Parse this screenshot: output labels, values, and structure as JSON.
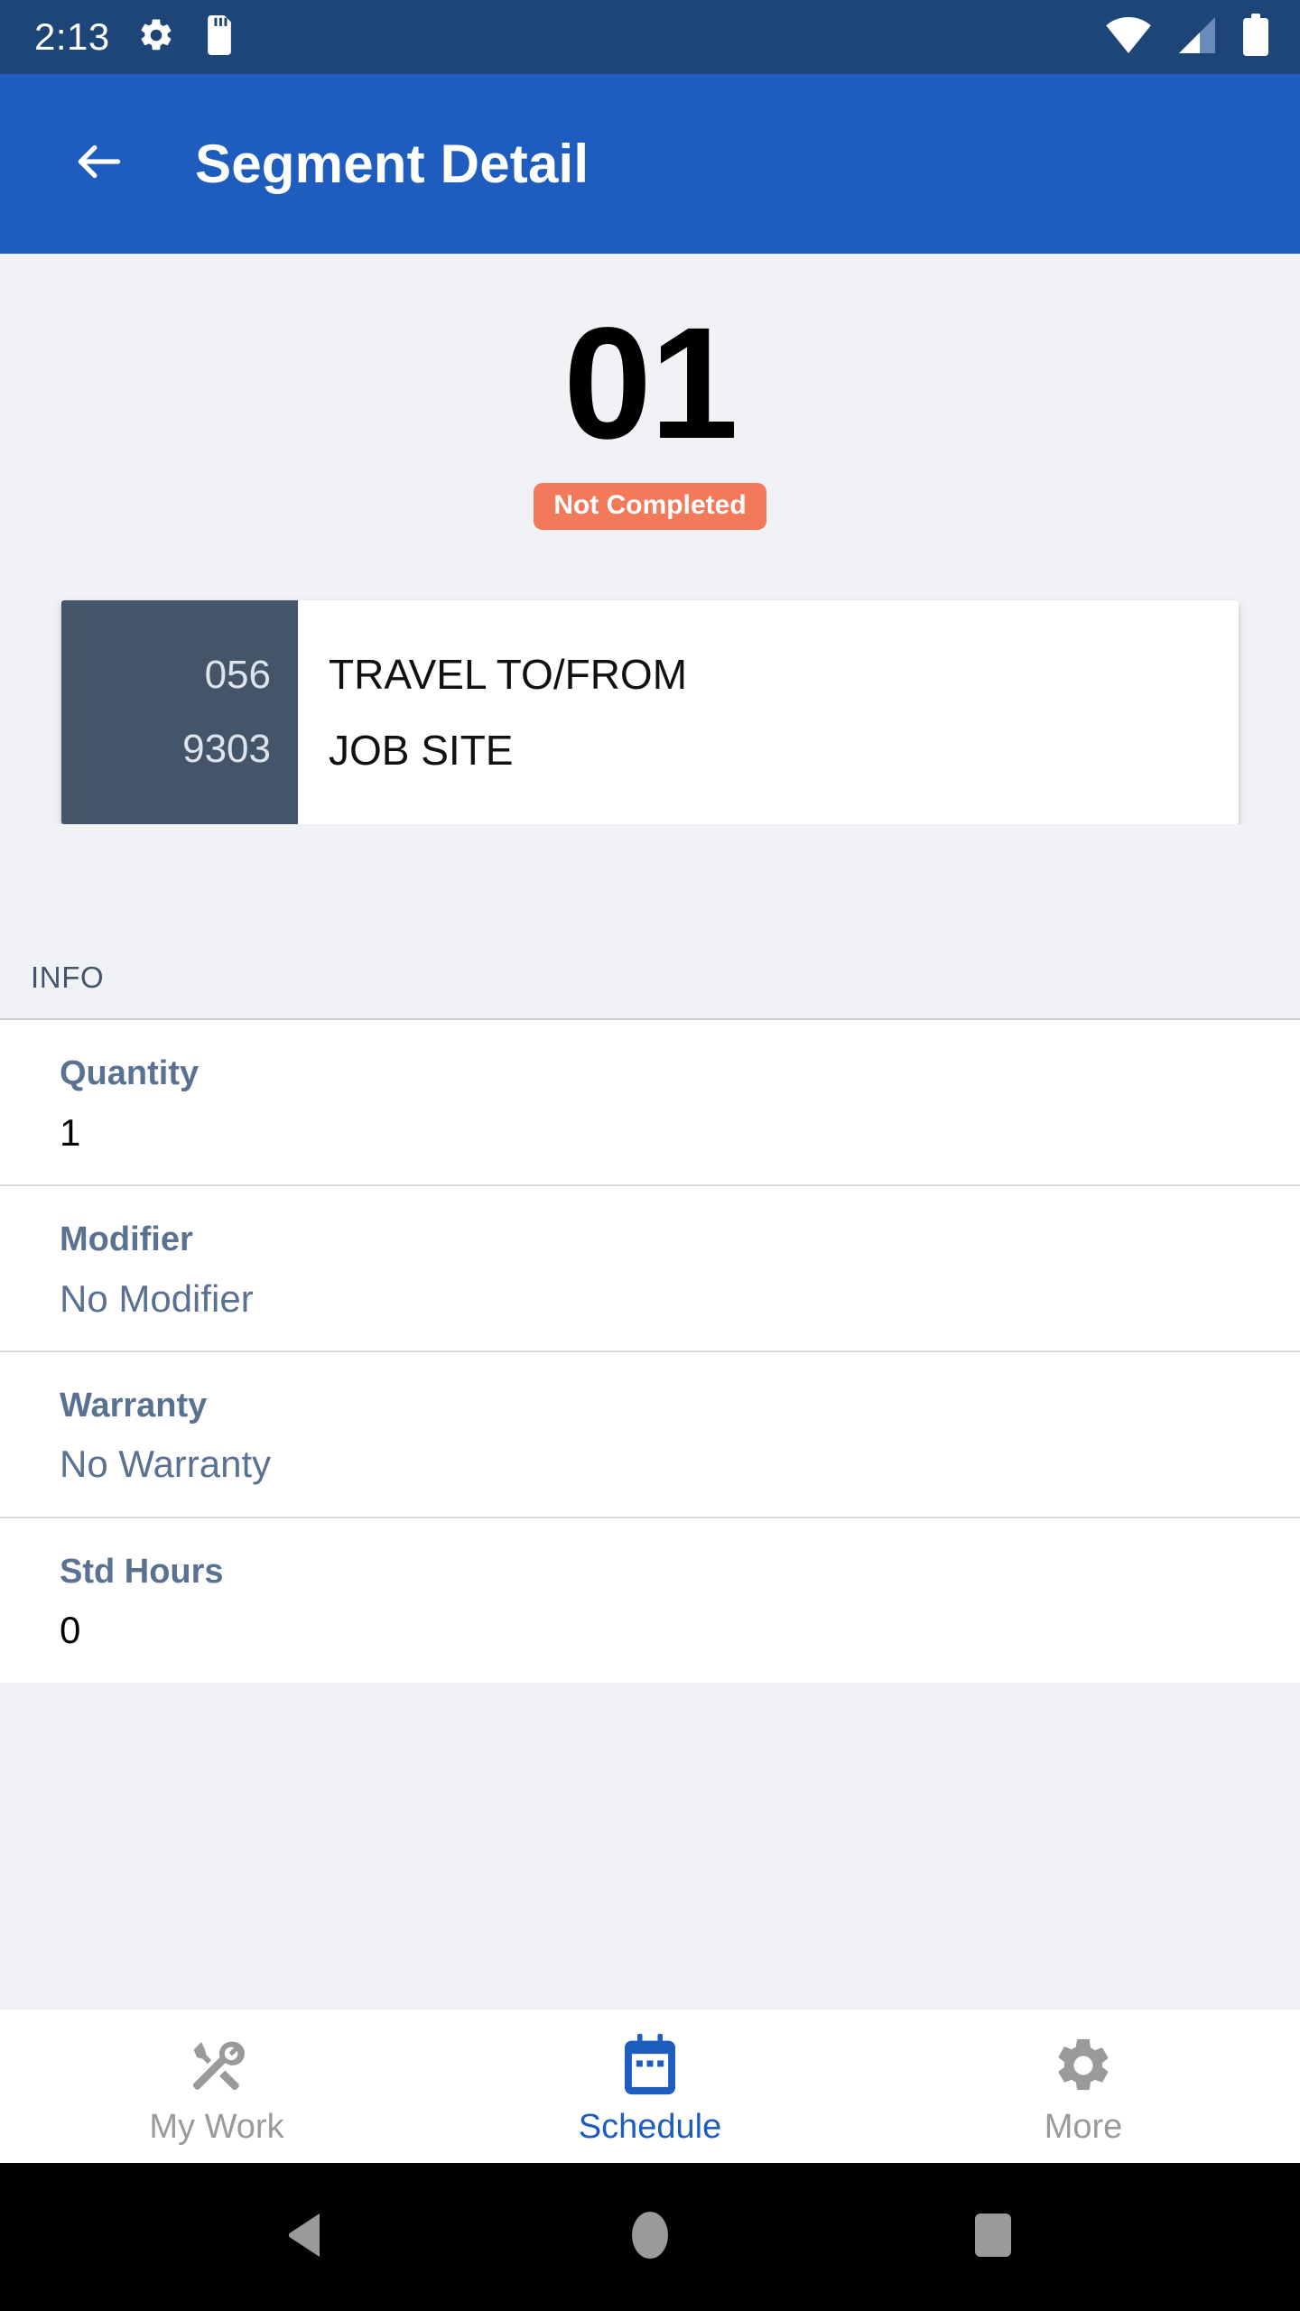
{
  "status_bar": {
    "time": "2:13",
    "left_icons": [
      "gear-icon",
      "sd-card-icon"
    ],
    "right_icons": [
      "wifi-icon",
      "cellular-signal-icon",
      "battery-icon"
    ],
    "background_color": "#1d4577"
  },
  "app_bar": {
    "back_icon": "arrow-left-icon",
    "title": "Segment Detail",
    "background_color": "#1e5cbd"
  },
  "hero": {
    "number": "01",
    "status_badge": "Not Completed",
    "badge_color": "#f2795a"
  },
  "code_card": {
    "codes": [
      "056",
      "9303"
    ],
    "descriptions": [
      "TRAVEL TO/FROM",
      "JOB SITE"
    ],
    "panel_color": "#455569"
  },
  "info": {
    "section_label": "INFO",
    "rows": [
      {
        "label": "Quantity",
        "value": "1",
        "muted": false
      },
      {
        "label": "Modifier",
        "value": "No Modifier",
        "muted": true
      },
      {
        "label": "Warranty",
        "value": "No Warranty",
        "muted": true
      },
      {
        "label": "Std Hours",
        "value": "0",
        "muted": false
      }
    ]
  },
  "bottom_nav": {
    "active_color": "#1e5cbd",
    "inactive_color": "#9a9a9a",
    "items": [
      {
        "label": "My Work",
        "icon": "tools-icon",
        "active": false
      },
      {
        "label": "Schedule",
        "icon": "calendar-icon",
        "active": true
      },
      {
        "label": "More",
        "icon": "gear-icon",
        "active": false
      }
    ]
  },
  "system_nav": {
    "buttons": [
      {
        "name": "back-triangle-icon"
      },
      {
        "name": "home-circle-icon"
      },
      {
        "name": "recents-square-icon"
      }
    ]
  }
}
